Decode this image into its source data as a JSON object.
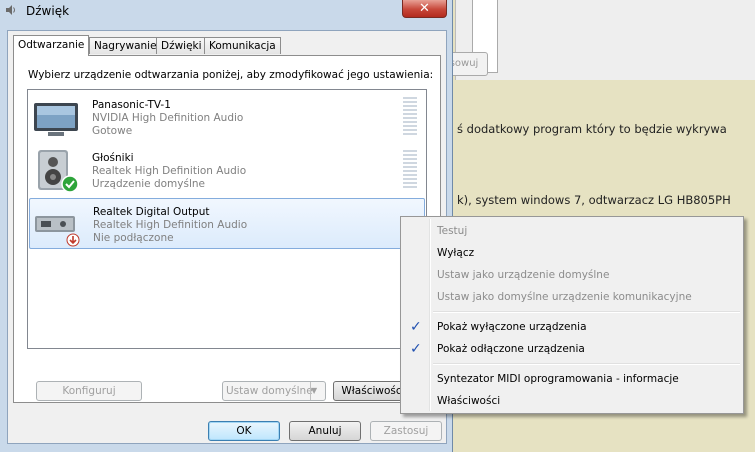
{
  "window": {
    "title": "Dźwięk",
    "close_glyph": "✕"
  },
  "tabs": [
    {
      "label": "Odtwarzanie",
      "active": true
    },
    {
      "label": "Nagrywanie",
      "active": false
    },
    {
      "label": "Dźwięki",
      "active": false
    },
    {
      "label": "Komunikacja",
      "active": false
    }
  ],
  "instruction": "Wybierz urządzenie odtwarzania poniżej, aby zmodyfikować jego ustawienia:",
  "devices": [
    {
      "name": "Panasonic-TV-1",
      "description": "NVIDIA High Definition Audio",
      "status": "Gotowe",
      "icon": "tv-icon"
    },
    {
      "name": "Głośniki",
      "description": "Realtek High Definition Audio",
      "status": "Urządzenie domyślne",
      "icon": "speaker-icon",
      "badge": "default-check-icon"
    },
    {
      "name": "Realtek Digital Output",
      "description": "Realtek High Definition Audio",
      "status": "Nie podłączone",
      "icon": "digital-output-icon",
      "badge": "disconnected-icon",
      "selected": true
    }
  ],
  "panel_buttons": {
    "configure": "Konfiguruj",
    "set_default": "Ustaw domyślne",
    "properties": "Właściwości"
  },
  "dialog_buttons": {
    "ok": "OK",
    "cancel": "Anuluj",
    "apply": "Zastosuj"
  },
  "context_menu": {
    "items": [
      {
        "label": "Testuj",
        "enabled": false
      },
      {
        "label": "Wyłącz",
        "enabled": true
      },
      {
        "label": "Ustaw jako urządzenie domyślne",
        "enabled": false
      },
      {
        "label": "Ustaw jako domyślne urządzenie komunikacyjne",
        "enabled": false
      },
      {
        "label": "Pokaż wyłączone urządzenia",
        "enabled": true,
        "checked": true
      },
      {
        "label": "Pokaż odłączone urządzenia",
        "enabled": true,
        "checked": true
      },
      {
        "label": "Syntezator MIDI oprogramowania - informacje",
        "enabled": true
      },
      {
        "label": "Właściwości",
        "enabled": true
      }
    ],
    "check_glyph": "✓"
  },
  "background": {
    "button_fragment": "sowuj",
    "text_lines": [
      "ś dodatkowy program który to będzie wykrywa",
      "k), system windows 7, odtwarzacz LG HB805PH"
    ]
  },
  "colors": {
    "title_bar": "#c9d9ea",
    "selection": "#dcebfc",
    "close_button": "#c7473a",
    "check": "#2050b0"
  }
}
